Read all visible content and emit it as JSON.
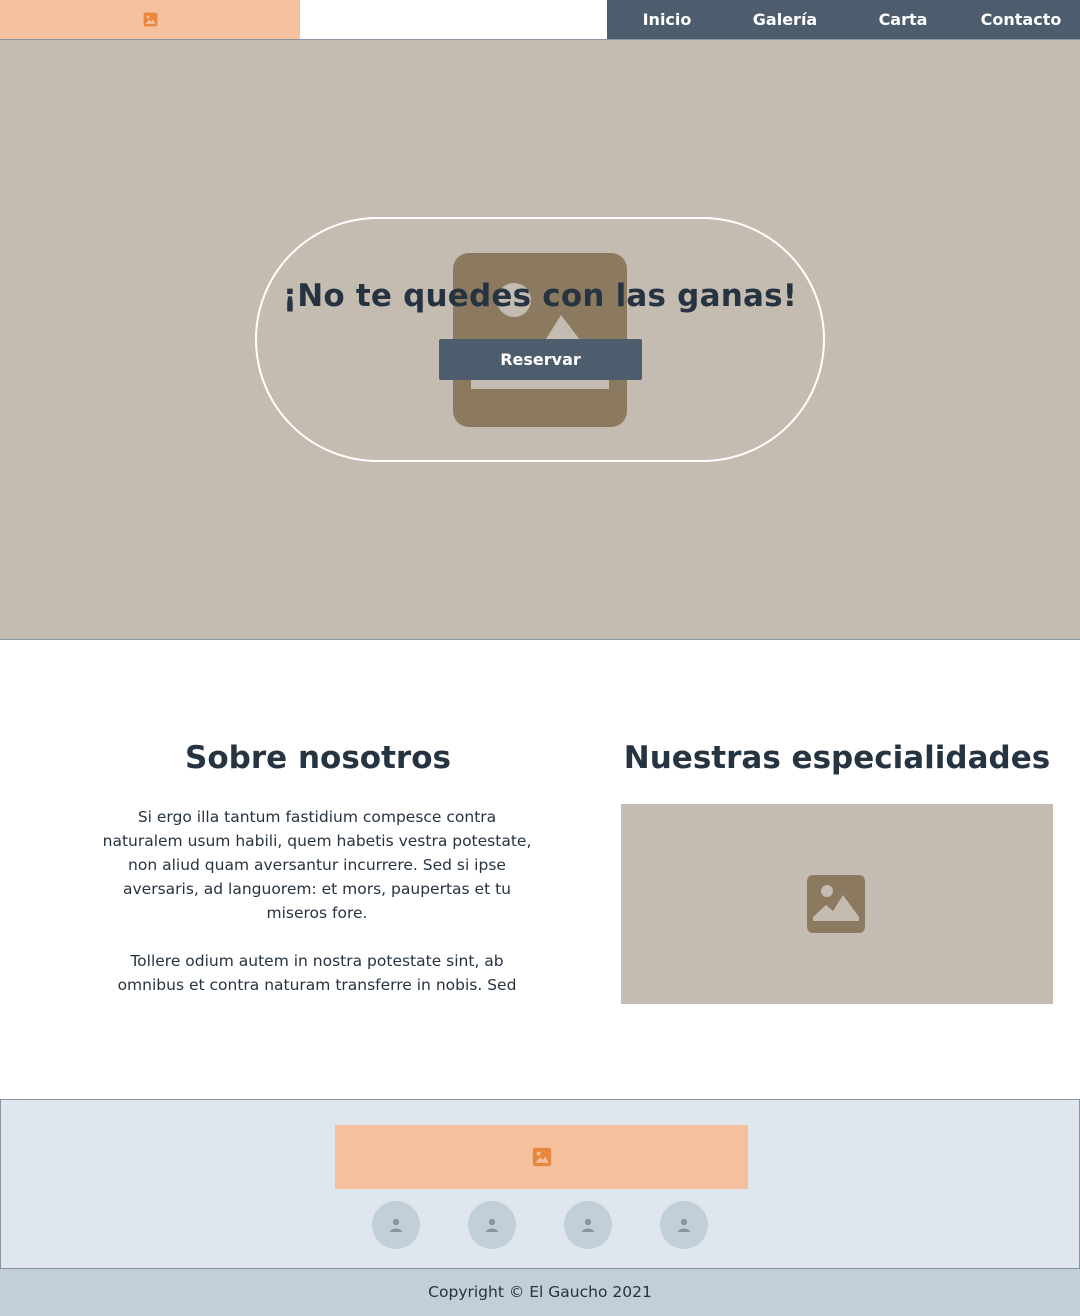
{
  "header": {
    "logo_icon": "image-placeholder-icon",
    "nav": [
      "Inicio",
      "Galería",
      "Carta",
      "Contacto"
    ]
  },
  "hero": {
    "title": "¡No te quedes con las ganas!",
    "button": "Reservar",
    "background_icon": "image-placeholder-icon"
  },
  "about": {
    "title": "Sobre nosotros",
    "paragraphs": [
      "Si ergo illa tantum fastidium compesce contra naturalem usum habili, quem habetis vestra potestate, non aliud quam aversantur incurrere. Sed si ipse aversaris, ad languorem: et mors, paupertas et tu miseros fore.",
      "Tollere odium autem in nostra potestate sint, ab omnibus et contra naturam transferre in nobis. Sed"
    ]
  },
  "specialties": {
    "title": "Nuestras especialidades",
    "image_icon": "image-placeholder-icon"
  },
  "footer": {
    "logo_icon": "image-placeholder-icon",
    "social_icons": [
      "user-icon",
      "user-icon",
      "user-icon",
      "user-icon"
    ],
    "copyright": "Copyright © El Gaucho 2021"
  },
  "colors": {
    "accent_orange": "#f4c09d",
    "icon_orange": "#e8873e",
    "nav_dark": "#4d5d6e",
    "hero_bg": "#c4bcb0",
    "placeholder_brown": "#8b7a5f",
    "footer_bg": "#dfe6ee",
    "copyright_bg": "#c2ced8",
    "text_dark": "#263341"
  }
}
